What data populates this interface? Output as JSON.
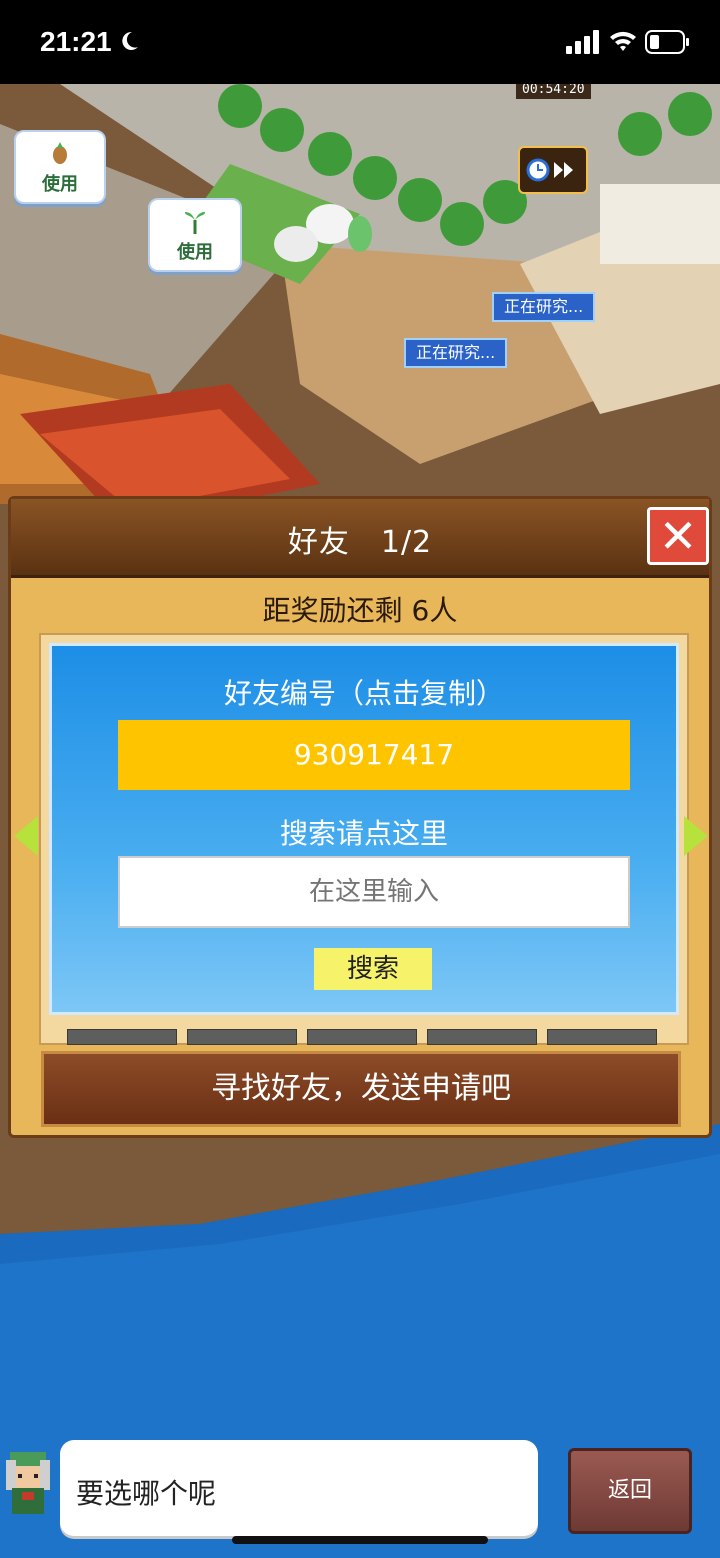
{
  "status_bar": {
    "time": "21:21"
  },
  "scene": {
    "use_label_1": "使用",
    "use_label_2": "使用",
    "research_1": "正在研究...",
    "research_2": "正在研究...",
    "timer": "00:54:20"
  },
  "friend_panel": {
    "title": "好友　1/2",
    "close_label": "✕",
    "reward_text": "距奖励还剩 6人",
    "id_title": "好友编号（点击复制）",
    "friend_id": "930917417",
    "search_title": "搜索请点这里",
    "search_placeholder": "在这里输入",
    "search_button": "搜索",
    "find_button": "寻找好友，发送申请吧"
  },
  "bottom": {
    "speech": "要选哪个呢",
    "back_button": "返回"
  }
}
